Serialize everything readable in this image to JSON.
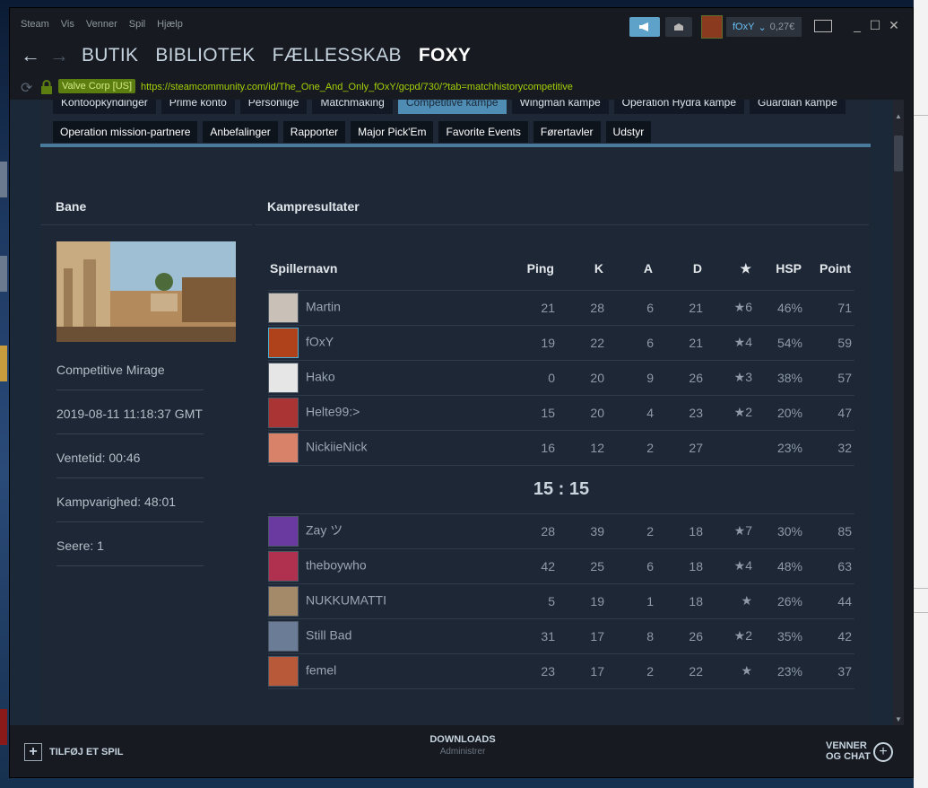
{
  "menu": [
    "Steam",
    "Vis",
    "Venner",
    "Spil",
    "Hjælp"
  ],
  "user": {
    "name": "fOxY",
    "balance": "0,27€"
  },
  "nav": {
    "tabs": [
      "BUTIK",
      "BIBLIOTEK",
      "FÆLLESSKAB",
      "FOXY"
    ]
  },
  "address": {
    "cert": "Valve Corp [US]",
    "url": "https://steamcommunity.com/id/The_One_And_Only_fOxY/gcpd/730/?tab=matchhistorycompetitive"
  },
  "subtabs_row1": [
    "Kontoopkyndinger",
    "Prime konto",
    "Personlige",
    "Matchmaking",
    "Competitive kampe",
    "Wingman kampe",
    "Operation Hydra kampe",
    "Guardian kampe"
  ],
  "subtabs": [
    "Operation mission-partnere",
    "Anbefalinger",
    "Rapporter",
    "Major Pick'Em",
    "Favorite Events",
    "Førertavler",
    "Udstyr"
  ],
  "left": {
    "header": "Bane",
    "map": "Competitive Mirage",
    "date": "2019-08-11 11:18:37 GMT",
    "wait": "Ventetid: 00:46",
    "duration": "Kampvarighed: 48:01",
    "viewers": "Seere: 1"
  },
  "results": {
    "header": "Kampresultater",
    "columns": [
      "Spillernavn",
      "Ping",
      "K",
      "A",
      "D",
      "★",
      "HSP",
      "Point"
    ],
    "score": "15 : 15",
    "team1": [
      {
        "name": "Martin",
        "ping": "21",
        "k": "28",
        "a": "6",
        "d": "21",
        "mvp": "★6",
        "hsp": "46%",
        "pts": "71"
      },
      {
        "name": "fOxY",
        "ping": "19",
        "k": "22",
        "a": "6",
        "d": "21",
        "mvp": "★4",
        "hsp": "54%",
        "pts": "59"
      },
      {
        "name": "Hako",
        "ping": "0",
        "k": "20",
        "a": "9",
        "d": "26",
        "mvp": "★3",
        "hsp": "38%",
        "pts": "57"
      },
      {
        "name": "Helte99:>",
        "ping": "15",
        "k": "20",
        "a": "4",
        "d": "23",
        "mvp": "★2",
        "hsp": "20%",
        "pts": "47"
      },
      {
        "name": "NickiieNick",
        "ping": "16",
        "k": "12",
        "a": "2",
        "d": "27",
        "mvp": "",
        "hsp": "23%",
        "pts": "32"
      }
    ],
    "team2": [
      {
        "name": "Zay ツ",
        "ping": "28",
        "k": "39",
        "a": "2",
        "d": "18",
        "mvp": "★7",
        "hsp": "30%",
        "pts": "85"
      },
      {
        "name": "theboywho",
        "ping": "42",
        "k": "25",
        "a": "6",
        "d": "18",
        "mvp": "★4",
        "hsp": "48%",
        "pts": "63"
      },
      {
        "name": "NUKKUMATTI",
        "ping": "5",
        "k": "19",
        "a": "1",
        "d": "18",
        "mvp": "★",
        "hsp": "26%",
        "pts": "44"
      },
      {
        "name": "Still Bad",
        "ping": "31",
        "k": "17",
        "a": "8",
        "d": "26",
        "mvp": "★2",
        "hsp": "35%",
        "pts": "42"
      },
      {
        "name": "femel",
        "ping": "23",
        "k": "17",
        "a": "2",
        "d": "22",
        "mvp": "★",
        "hsp": "23%",
        "pts": "37"
      }
    ]
  },
  "bottom": {
    "add_game": "TILFØJ ET SPIL",
    "downloads": "DOWNLOADS",
    "downloads_sub": "Administrer",
    "friends_1": "VENNER",
    "friends_2": "OG CHAT"
  },
  "avatar_colors": [
    "#c9c1b8",
    "#b0421b",
    "#e6e6e6",
    "#a33",
    "#d8826a",
    "#6a3aa0",
    "#b03050",
    "#a58a6a",
    "#6a7c96",
    "#b8593a"
  ]
}
